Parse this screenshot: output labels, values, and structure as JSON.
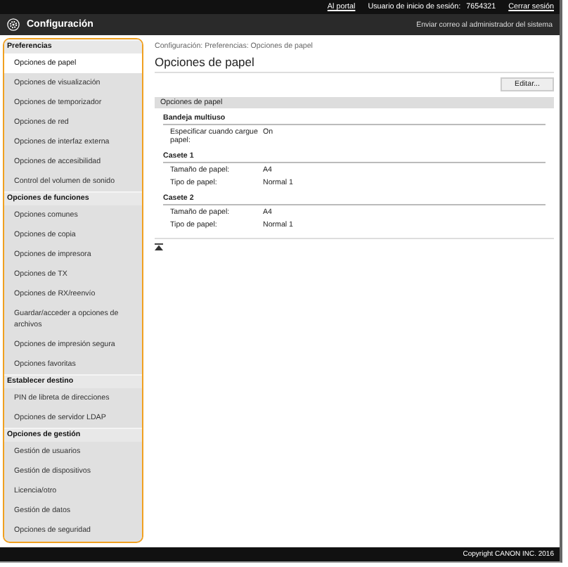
{
  "top_bar": {
    "portal_link": "Al portal",
    "user_label": "Usuario de inicio de sesión:",
    "user_id": "7654321",
    "logout_link": "Cerrar sesión"
  },
  "header": {
    "title": "Configuración",
    "mail_link": "Enviar correo al administrador del sistema"
  },
  "sidebar": {
    "sections": [
      {
        "title": "Preferencias",
        "items": [
          {
            "label": "Opciones de papel",
            "selected": true
          },
          {
            "label": "Opciones de visualización",
            "selected": false
          },
          {
            "label": "Opciones de temporizador",
            "selected": false
          },
          {
            "label": "Opciones de red",
            "selected": false
          },
          {
            "label": "Opciones de interfaz externa",
            "selected": false
          },
          {
            "label": "Opciones de accesibilidad",
            "selected": false
          },
          {
            "label": "Control del volumen de sonido",
            "selected": false
          }
        ]
      },
      {
        "title": "Opciones de funciones",
        "items": [
          {
            "label": "Opciones comunes",
            "selected": false
          },
          {
            "label": "Opciones de copia",
            "selected": false
          },
          {
            "label": "Opciones de impresora",
            "selected": false
          },
          {
            "label": "Opciones de TX",
            "selected": false
          },
          {
            "label": "Opciones de RX/reenvío",
            "selected": false
          },
          {
            "label": "Guardar/acceder a opciones de archivos",
            "selected": false
          },
          {
            "label": "Opciones de impresión segura",
            "selected": false
          },
          {
            "label": "Opciones favoritas",
            "selected": false
          }
        ]
      },
      {
        "title": "Establecer destino",
        "items": [
          {
            "label": "PIN de libreta de direcciones",
            "selected": false
          },
          {
            "label": "Opciones de servidor LDAP",
            "selected": false
          }
        ]
      },
      {
        "title": "Opciones de gestión",
        "items": [
          {
            "label": "Gestión de usuarios",
            "selected": false
          },
          {
            "label": "Gestión de dispositivos",
            "selected": false
          },
          {
            "label": "Licencia/otro",
            "selected": false
          },
          {
            "label": "Gestión de datos",
            "selected": false
          },
          {
            "label": "Opciones de seguridad",
            "selected": false
          }
        ]
      }
    ]
  },
  "breadcrumb": "Configuración: Preferencias: Opciones de papel",
  "page_title": "Opciones de papel",
  "edit_button": "Editar...",
  "panel": {
    "title": "Opciones de papel",
    "groups": [
      {
        "title": "Bandeja multiuso",
        "rows": [
          {
            "label": "Especificar cuando cargue papel:",
            "value": "On"
          }
        ]
      },
      {
        "title": "Casete 1",
        "rows": [
          {
            "label": "Tamaño de papel:",
            "value": "A4"
          },
          {
            "label": "Tipo de papel:",
            "value": "Normal 1"
          }
        ]
      },
      {
        "title": "Casete 2",
        "rows": [
          {
            "label": "Tamaño de papel:",
            "value": "A4"
          },
          {
            "label": "Tipo de papel:",
            "value": "Normal 1"
          }
        ]
      }
    ]
  },
  "footer": "Copyright CANON INC. 2016"
}
